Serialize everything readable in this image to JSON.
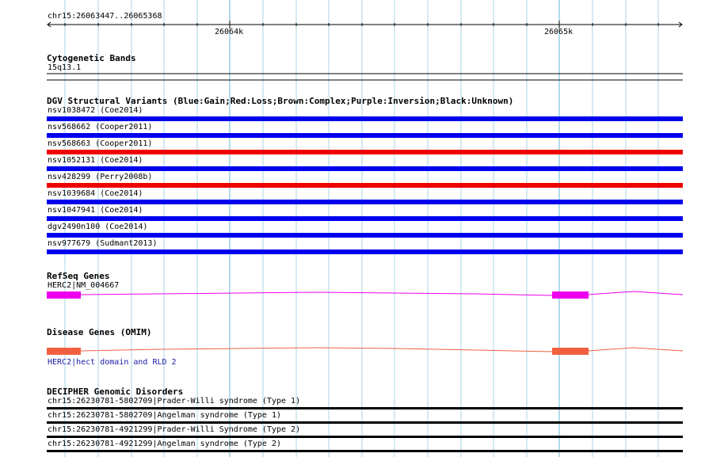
{
  "ruler": {
    "location": "chr15:26063447..26065368",
    "tick_left": "26064k",
    "tick_right": "26065k"
  },
  "cytoband": {
    "title": "Cytogenetic Bands",
    "band": "15q13.1"
  },
  "dgv": {
    "title": "DGV Structural Variants (Blue:Gain;Red:Loss;Brown:Complex;Purple:Inversion;Black:Unknown)",
    "items": [
      {
        "label": "nsv1038472 (Coe2014)",
        "color": "#0000ee"
      },
      {
        "label": "nsv568662 (Cooper2011)",
        "color": "#0000ee"
      },
      {
        "label": "nsv568663 (Cooper2011)",
        "color": "#ee0000"
      },
      {
        "label": "nsv1052131 (Coe2014)",
        "color": "#0000ee"
      },
      {
        "label": "nsv428299 (Perry2008b)",
        "color": "#ee0000"
      },
      {
        "label": "nsv1039684 (Coe2014)",
        "color": "#0000ee"
      },
      {
        "label": "nsv1047941 (Coe2014)",
        "color": "#0000ee"
      },
      {
        "label": "dgv2490n100 (Coe2014)",
        "color": "#0000ee"
      },
      {
        "label": "nsv977679 (Sudmant2013)",
        "color": "#0000ee"
      }
    ]
  },
  "refseq": {
    "title": "RefSeq Genes",
    "gene": "HERC2|NM_004667",
    "color": "#ee00ee"
  },
  "omim": {
    "title": "Disease Genes (OMIM)",
    "gene": "HERC2|hect domain and RLD 2",
    "color": "#f06040"
  },
  "decipher": {
    "title": "DECIPHER Genomic Disorders",
    "items": [
      {
        "label": "chr15:26230781-5802709|Prader-Willi syndrome (Type 1)"
      },
      {
        "label": "chr15:26230781-5802709|Angelman syndrome (Type 1)"
      },
      {
        "label": "chr15:26230781-4921299|Prader-Willi Syndrome (Type 2)"
      },
      {
        "label": "chr15:26230781-4921299|Angelman syndrome (Type 2)"
      }
    ]
  }
}
